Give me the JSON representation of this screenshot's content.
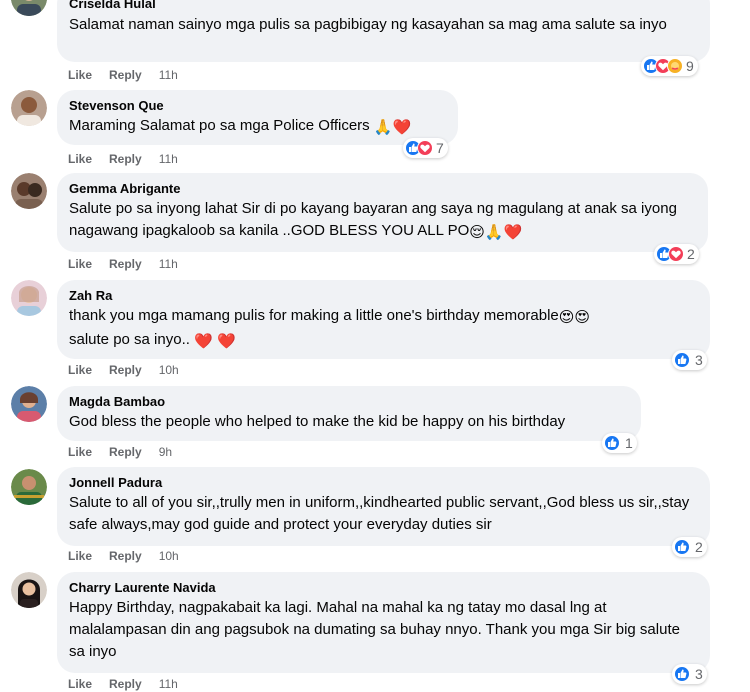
{
  "comments": [
    {
      "name": "Criselda Hulal",
      "text": "Salamat naman sainyo mga pulis sa pagbibigay ng kasayahan sa mag ama salute sa inyo",
      "like": "Like",
      "reply": "Reply",
      "time": "11h",
      "reactions": [
        "like",
        "love",
        "care"
      ],
      "count": "9",
      "avatar_color": "#7a8a6a"
    },
    {
      "name": "Stevenson Que",
      "text": "Maraming Salamat po sa mga Police Officers",
      "emojis": "🙏❤️",
      "like": "Like",
      "reply": "Reply",
      "time": "11h",
      "reactions": [
        "like",
        "love"
      ],
      "count": "7",
      "avatar_color": "#8b5a3c"
    },
    {
      "name": "Gemma Abrigante",
      "text": "Salute po sa inyong lahat Sir di po kayang bayaran ang saya ng magulang at anak sa iyong nagawang ipagkaloob sa kanila ..GOD BLESS YOU ALL PO",
      "emojis": "😌🙏❤️",
      "like": "Like",
      "reply": "Reply",
      "time": "11h",
      "reactions": [
        "like",
        "love"
      ],
      "count": "2",
      "avatar_color": "#6b4a3a"
    },
    {
      "name": "Zah Ra",
      "text": "thank you mga mamang pulis for making a little one's birthday memorable",
      "emojis": "😍😍",
      "text2": "salute po sa inyo..",
      "emojis2": "❤️ ❤️",
      "like": "Like",
      "reply": "Reply",
      "time": "10h",
      "reactions": [
        "like"
      ],
      "count": "3",
      "avatar_color": "#c9a7b5"
    },
    {
      "name": "Magda Bambao",
      "text": "God bless the people who helped to make the kid be happy on his birthday",
      "like": "Like",
      "reply": "Reply",
      "time": "9h",
      "reactions": [
        "like"
      ],
      "count": "1",
      "avatar_color": "#5c7fa8"
    },
    {
      "name": "Jonnell Padura",
      "text": "Salute to all of you sir,,trully men in uniform,,kindhearted public servant,,God bless us sir,,stay safe always,may god guide and protect your everyday duties sir",
      "like": "Like",
      "reply": "Reply",
      "time": "10h",
      "reactions": [
        "like"
      ],
      "count": "2",
      "avatar_color": "#5a7a3a"
    },
    {
      "name": "Charry Laurente Navida",
      "text": "Happy Birthday, nagpakabait ka lagi. Mahal na mahal ka ng tatay mo dasal lng at malalampasan din ang pagsubok na dumating sa buhay nnyo. Thank you mga Sir big salute sa inyo",
      "like": "Like",
      "reply": "Reply",
      "time": "11h",
      "reactions": [
        "like"
      ],
      "count": "3",
      "avatar_color": "#2a2020"
    }
  ]
}
